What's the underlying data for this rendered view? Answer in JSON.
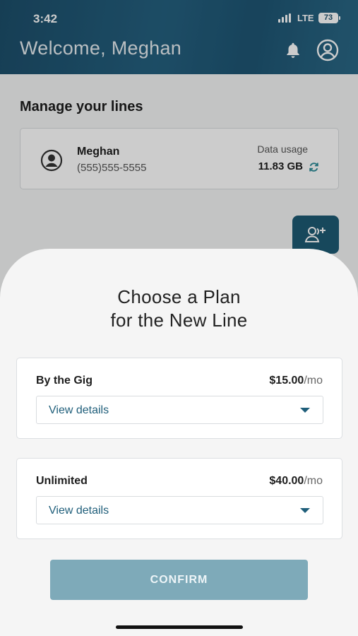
{
  "status_bar": {
    "time": "3:42",
    "network": "LTE",
    "battery": "73"
  },
  "header": {
    "welcome": "Welcome, Meghan",
    "icons": [
      "bell-icon",
      "profile-icon"
    ]
  },
  "manage": {
    "title": "Manage your lines",
    "line": {
      "name": "Meghan",
      "phone": "(555)555-5555",
      "usage_label": "Data usage",
      "usage_value": "11.83 GB"
    },
    "add_line_icon": "add-user-icon"
  },
  "sheet": {
    "title_line1": "Choose a Plan",
    "title_line2": "for the New Line",
    "plans": [
      {
        "name": "By the Gig",
        "price": "$15.00",
        "per": "/mo",
        "details_label": "View details"
      },
      {
        "name": "Unlimited",
        "price": "$40.00",
        "per": "/mo",
        "details_label": "View details"
      }
    ],
    "confirm_label": "CONFIRM"
  },
  "colors": {
    "header": "#1c4e6a",
    "accent": "#1f5e7a",
    "confirm": "#7eaab9"
  }
}
